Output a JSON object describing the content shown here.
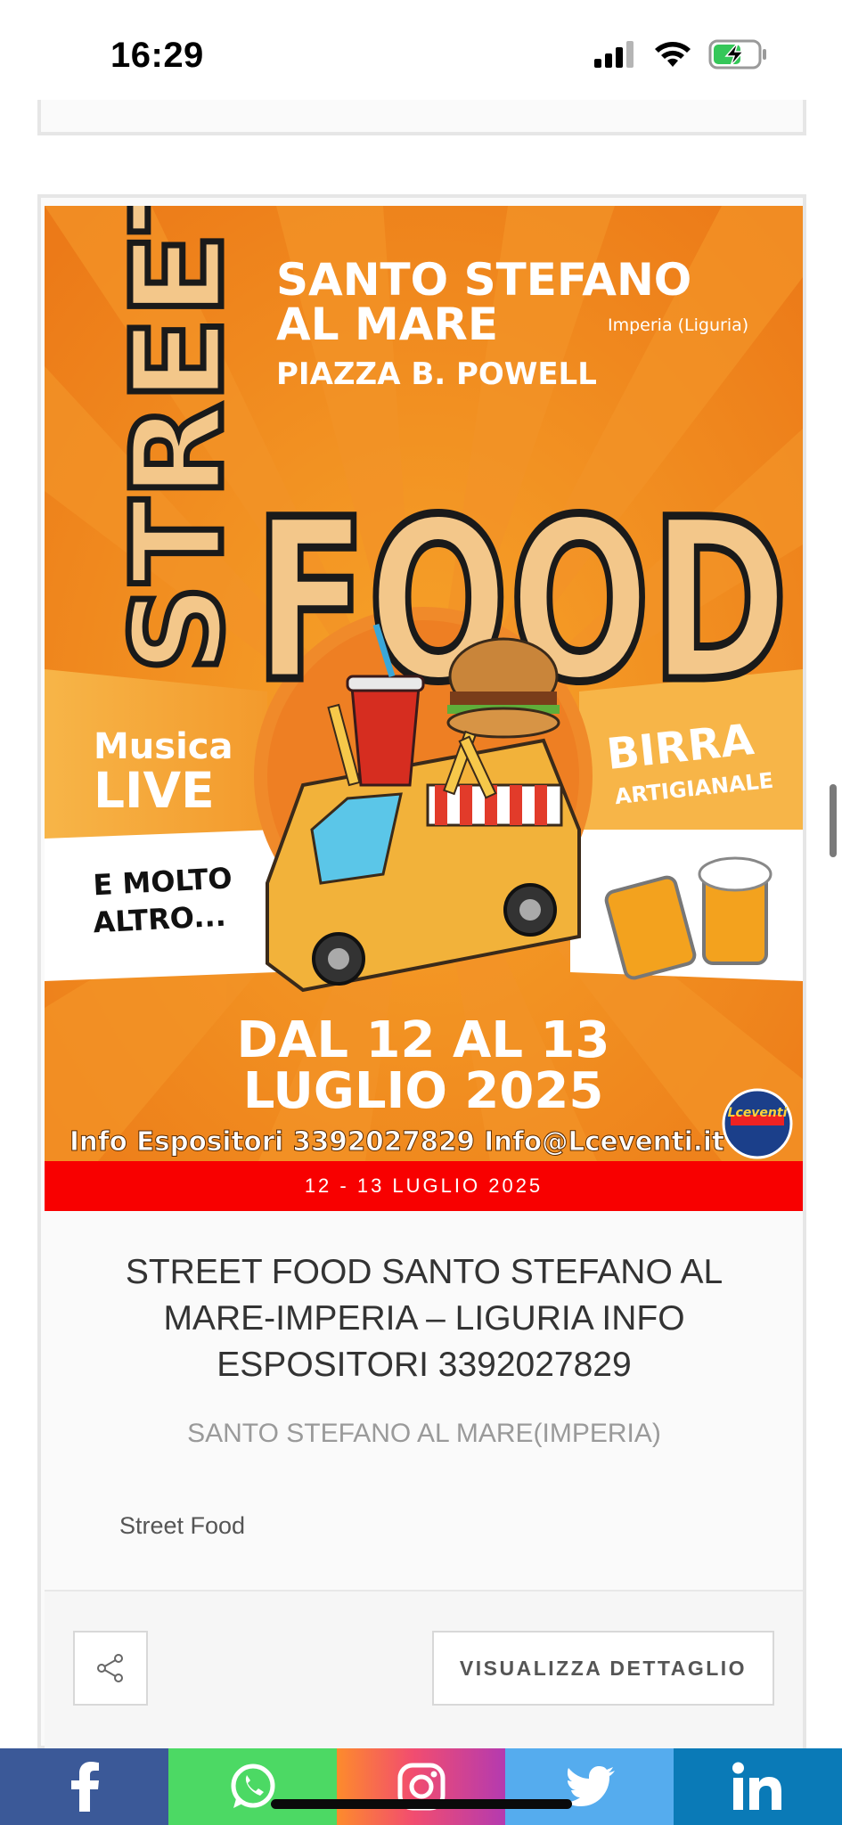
{
  "status": {
    "time": "16:29"
  },
  "event": {
    "date_badge": "12 - 13 LUGLIO 2025",
    "title": "STREET FOOD SANTO STEFANO AL MARE-IMPERIA – LIGURIA INFO ESPOSITORI 3392027829",
    "location": "SANTO STEFANO AL MARE(IMPERIA)",
    "category": "Street Food",
    "detail_button": "VISUALIZZA DETTAGLIO"
  },
  "poster": {
    "street": "STREET",
    "food": "FOOD",
    "town_line1": "SANTO STEFANO",
    "town_line2": "AL MARE",
    "region": "Imperia (Liguria)",
    "square": "PIAZZA B. POWELL",
    "music_line1": "Musica",
    "music_line2": "LIVE",
    "beer_line1": "BIRRA",
    "beer_line2": "ARTIGIANALE",
    "more_line1": "E MOLTO",
    "more_line2": "ALTRO...",
    "dates_line1": "DAL 12 AL 13",
    "dates_line2": "LUGLIO 2025",
    "info": "Info Espositori 3392027829 Info@Lceventi.it",
    "logo_text": "Lceventi"
  },
  "social": [
    {
      "name": "facebook",
      "color": "#3b5998"
    },
    {
      "name": "whatsapp",
      "color": "#4cd964"
    },
    {
      "name": "instagram",
      "color": "#f24d6f"
    },
    {
      "name": "twitter",
      "color": "#55acee"
    },
    {
      "name": "linkedin",
      "color": "#0a7ab7"
    }
  ]
}
